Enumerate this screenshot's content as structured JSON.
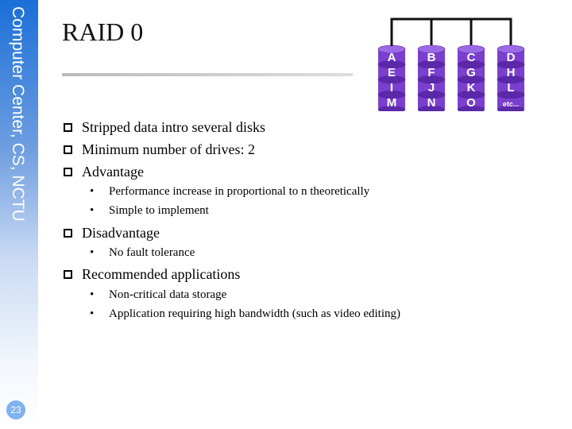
{
  "sidebar": {
    "title": "Computer Center, CS, NCTU",
    "page_number": "23"
  },
  "slide": {
    "title": "RAID 0",
    "bullets": [
      {
        "text": "Stripped data intro several disks"
      },
      {
        "text": "Minimum number of drives: 2"
      },
      {
        "text": "Advantage",
        "sub": [
          "Performance increase in proportional to n theoretically",
          "Simple to implement"
        ]
      },
      {
        "text": "Disadvantage",
        "sub": [
          "No fault tolerance"
        ]
      },
      {
        "text": "Recommended applications",
        "sub": [
          "Non-critical data storage",
          "Application requiring high bandwidth (such as video editing)"
        ]
      }
    ]
  },
  "diagram": {
    "disk_color": "#7b3fd0",
    "disks": [
      [
        "A",
        "E",
        "I",
        "M"
      ],
      [
        "B",
        "F",
        "J",
        "N"
      ],
      [
        "C",
        "G",
        "K",
        "O"
      ],
      [
        "D",
        "H",
        "L",
        "etc..."
      ]
    ]
  }
}
